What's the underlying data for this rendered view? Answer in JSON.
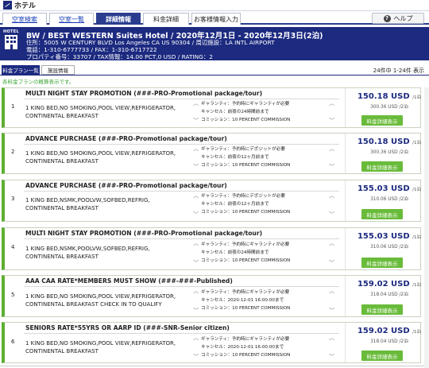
{
  "app_title": "ホテル",
  "tabs": [
    {
      "label": "空室検索",
      "state": "link"
    },
    {
      "label": "空室一覧",
      "state": "link"
    },
    {
      "label": "詳細情報",
      "state": "active"
    },
    {
      "label": "料金詳細",
      "state": "plain"
    },
    {
      "label": "お客様情報入力",
      "state": "plain"
    }
  ],
  "help_label": "ヘルプ",
  "hotel": {
    "icon_label": "HOTEL",
    "name": "BW / BEST WESTERN Suites Hotel / 2020年12月1日 - 2020年12月3日(2泊)",
    "address": "住所：5005 W CENTURY BLVD Los Angeles CA US 90304 / 周辺施設：LA INTL AIRPORT",
    "phone": "電話：1-310-6777733 / FAX：1-310-6717722",
    "property": "プロパティ番号：33707 / TAX情報：14.00 PCT,0 USD / RATING：2"
  },
  "subtabs": {
    "plans": "料金プラン一覧",
    "facility": "施設情報"
  },
  "count_text": "24件中 1-24件 表示",
  "note": "各料金プランの概算表示です。",
  "detail_button_label": "料金詳細表示",
  "colors": {
    "navy": "#1c2a80",
    "green": "#69bb3a",
    "link": "#1a3eb5"
  },
  "plans": [
    {
      "num": "1",
      "title": "MULTI NIGHT STAY PROMOTION (###-PRO-Promotional package/tour)",
      "desc": "1 KING BED,NO SMOKING,POOL VIEW,REFRIGERATOR, CONTINENTAL BREAKFAST",
      "guarantee": "ギャランティ：予約時にギャランティが必要",
      "cancel": "キャンセル：前夜の24時間前まで",
      "commission": "コミッション：10 PERCENT COMMISSION",
      "price": "150.18 USD",
      "unit": "/1泊",
      "total": "300.36 USD /2泊"
    },
    {
      "num": "2",
      "title": "ADVANCE PURCHASE (###-PRO-Promotional package/tour)",
      "desc": "1 KING BED,NO SMOKING,POOL VIEW,REFRIGERATOR, CONTINENTAL BREAKFAST",
      "guarantee": "ギャランティ：予約時にデポジットが必要",
      "cancel": "キャンセル：前夜の12ヶ月前まで",
      "commission": "コミッション：10 PERCENT COMMISSION",
      "price": "150.18 USD",
      "unit": "/1泊",
      "total": "300.36 USD /2泊"
    },
    {
      "num": "3",
      "title": "ADVANCE PURCHASE (###-PRO-Promotional package/tour)",
      "desc": "1 KING BED,NSMK,POOLVW,SOFBED,REFRIG, CONTINENTAL BREAKFAST",
      "guarantee": "ギャランティ：予約時にデポジットが必要",
      "cancel": "キャンセル：前夜の12ヶ月前まで",
      "commission": "コミッション：10 PERCENT COMMISSION",
      "price": "155.03 USD",
      "unit": "/1泊",
      "total": "310.06 USD /2泊"
    },
    {
      "num": "4",
      "title": "MULTI NIGHT STAY PROMOTION (###-PRO-Promotional package/tour)",
      "desc": "1 KING BED,NSMK,POOLVW,SOFBED,REFRIG, CONTINENTAL BREAKFAST",
      "guarantee": "ギャランティ：予約時にギャランティが必要",
      "cancel": "キャンセル：前夜の24時間前まで",
      "commission": "コミッション：10 PERCENT COMMISSION",
      "price": "155.03 USD",
      "unit": "/1泊",
      "total": "310.06 USD /2泊"
    },
    {
      "num": "5",
      "title": "AAA CAA RATE*MEMBERS MUST SHOW (###-###-Published)",
      "desc": "1 KING BED,NO SMOKING,POOL VIEW,REFRIGERATOR, CONTINENTAL BREAKFAST CHECK IN TO QUALIFY",
      "guarantee": "ギャランティ：予約時にギャランティが必要",
      "cancel": "キャンセル：2020-12-01 16:00:00まで",
      "commission": "コミッション：10 PERCENT COMMISSION",
      "price": "159.02 USD",
      "unit": "/1泊",
      "total": "318.04 USD /2泊"
    },
    {
      "num": "6",
      "title": "SENIORS RATE*55YRS OR AARP ID (###-SNR-Senior citizen)",
      "desc": "1 KING BED,NO SMOKING,POOL VIEW,REFRIGERATOR, CONTINENTAL BREAKFAST",
      "guarantee": "ギャランティ：予約時にギャランティが必要",
      "cancel": "キャンセル：2020-12-01 16:00:00まで",
      "commission": "コミッション：10 PERCENT COMMISSION",
      "price": "159.02 USD",
      "unit": "/1泊",
      "total": "318.04 USD /2泊"
    }
  ]
}
